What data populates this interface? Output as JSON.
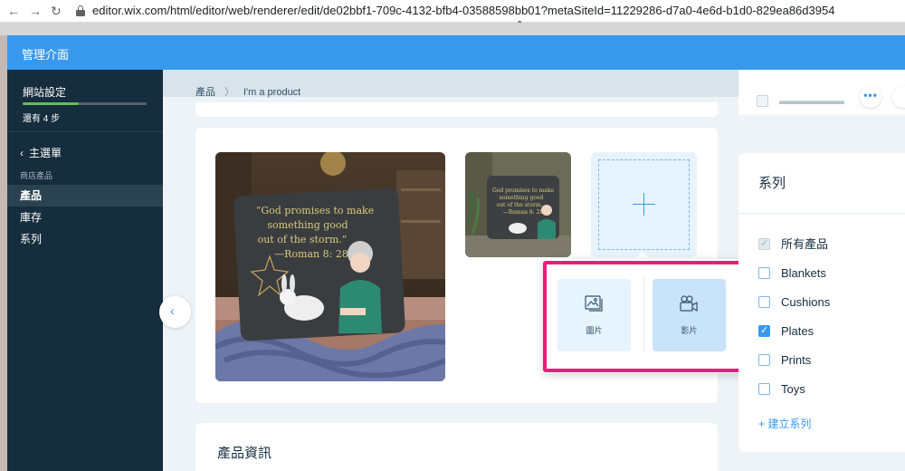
{
  "browser": {
    "url": "editor.wix.com/html/editor/web/renderer/edit/de02bbf1-709c-4132-bfb4-03588598bb01?metaSiteId=11229286-d7a0-4e6d-b1d0-829ea86d3954"
  },
  "modal": {
    "title": "管理介面"
  },
  "sidebar": {
    "site_label": "網站設定",
    "progress": 0.45,
    "steps_left": "還有 4 步",
    "back_label": "主選單",
    "section_label": "商店產品",
    "items": [
      {
        "label": "產品",
        "active": true
      },
      {
        "label": "庫存",
        "active": false
      },
      {
        "label": "系列",
        "active": false
      }
    ]
  },
  "breadcrumb": {
    "parent": "產品",
    "current": "I'm a product"
  },
  "media": {
    "main_image_alt": "pillow with bible verse",
    "quote_lines": [
      "“God promises to make",
      "something good",
      "out of the storm.”",
      "—Roman 8: 28"
    ],
    "thumb_quote_lines": [
      "God promises to make",
      "something good",
      "out of the storm.",
      "—Roman 8: 28"
    ]
  },
  "media_popup": {
    "image_label": "圖片",
    "video_label": "影片"
  },
  "product_info": {
    "title": "產品資訊"
  },
  "collections": {
    "title": "系列",
    "items": [
      {
        "label": "所有產品",
        "checked": true,
        "disabled": true
      },
      {
        "label": "Blankets",
        "checked": false,
        "disabled": false
      },
      {
        "label": "Cushions",
        "checked": false,
        "disabled": false
      },
      {
        "label": "Plates",
        "checked": true,
        "disabled": false
      },
      {
        "label": "Prints",
        "checked": false,
        "disabled": false
      },
      {
        "label": "Toys",
        "checked": false,
        "disabled": false
      }
    ],
    "add_label": "+ 建立系列"
  },
  "colors": {
    "accent": "#3899ec",
    "sidebar_bg": "#162d3d",
    "highlight": "#f0197c",
    "progress": "#60bc57"
  }
}
